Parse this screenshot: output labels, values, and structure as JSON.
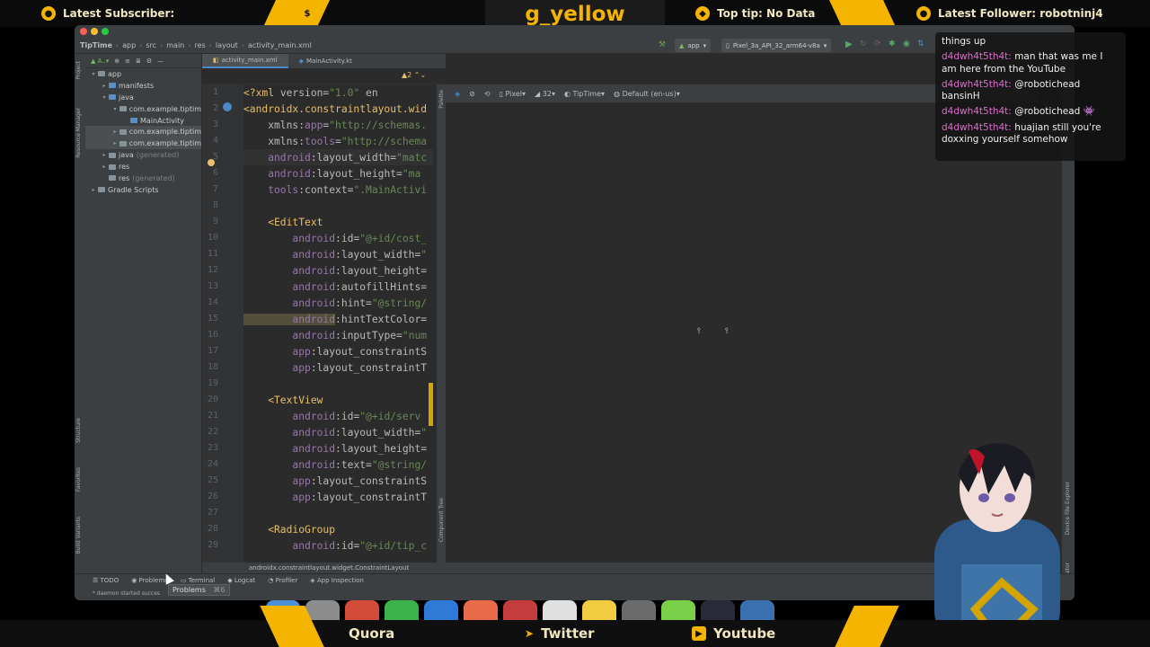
{
  "overlay": {
    "latest_subscriber_label": "Latest Subscriber:",
    "channel_name": "g_yellow",
    "top_tip": "Top tip: No Data",
    "latest_follower": "Latest Follower: robotninj4",
    "bottom_links": [
      "Quora",
      "Twitter",
      "Youtube"
    ]
  },
  "ide": {
    "breadcrumb": [
      "TipTime",
      "app",
      "src",
      "main",
      "res",
      "layout",
      "activity_main.xml"
    ],
    "run_config": "app",
    "device": "Pixel_3a_API_32_arm64-v8a",
    "project_items": [
      {
        "label": "app",
        "indent": 0,
        "arrow": "▾",
        "icon": "folder",
        "muted": ""
      },
      {
        "label": "manifests",
        "indent": 1,
        "arrow": "▸",
        "icon": "blue",
        "muted": ""
      },
      {
        "label": "java",
        "indent": 1,
        "arrow": "▾",
        "icon": "blue",
        "muted": ""
      },
      {
        "label": "com.example.tiptim",
        "indent": 2,
        "arrow": "▾",
        "icon": "folder",
        "muted": ""
      },
      {
        "label": "MainActivity",
        "indent": 3,
        "arrow": "",
        "icon": "blue",
        "muted": ""
      },
      {
        "label": "com.example.tiptim",
        "indent": 2,
        "arrow": "▸",
        "icon": "folder",
        "muted": "",
        "sel": true
      },
      {
        "label": "com.example.tiptim",
        "indent": 2,
        "arrow": "▸",
        "icon": "folder",
        "muted": "",
        "sel": true
      },
      {
        "label": "java",
        "indent": 1,
        "arrow": "▸",
        "icon": "folder",
        "muted": "(generated)"
      },
      {
        "label": "res",
        "indent": 1,
        "arrow": "▸",
        "icon": "folder",
        "muted": ""
      },
      {
        "label": "res",
        "indent": 1,
        "arrow": "",
        "icon": "folder",
        "muted": "(generated)"
      },
      {
        "label": "Gradle Scripts",
        "indent": 0,
        "arrow": "▸",
        "icon": "folder",
        "muted": ""
      }
    ],
    "tabs": [
      "activity_main.xml",
      "MainActivity.kt"
    ],
    "design_toolbar": {
      "device": "Pixel",
      "api": "32",
      "theme": "TipTime",
      "locale": "Default (en-us)"
    },
    "code_lines": [
      {
        "n": "1",
        "parts": [
          [
            "xmlp",
            "<?xml "
          ],
          [
            "attr",
            "version="
          ],
          [
            "val",
            "\"1.0\""
          ],
          [
            "attr",
            " en"
          ]
        ]
      },
      {
        "n": "2",
        "parts": [
          [
            "tag",
            "<androidx.constraintlayout.wid"
          ]
        ]
      },
      {
        "n": "3",
        "parts": [
          [
            "attr",
            "    xmlns:"
          ],
          [
            "attr-ns",
            "app"
          ],
          [
            "attr",
            "="
          ],
          [
            "val",
            "\"http://schemas."
          ]
        ]
      },
      {
        "n": "4",
        "parts": [
          [
            "attr",
            "    xmlns:"
          ],
          [
            "attr-ns",
            "tools"
          ],
          [
            "attr",
            "="
          ],
          [
            "val",
            "\"http://schema"
          ]
        ]
      },
      {
        "n": "5",
        "parts": [
          [
            "attr-ns",
            "    android"
          ],
          [
            "attr",
            ":layout_width="
          ],
          [
            "val",
            "\"matc"
          ]
        ],
        "hl": true
      },
      {
        "n": "6",
        "parts": [
          [
            "attr-ns",
            "    android"
          ],
          [
            "attr",
            ":layout_height="
          ],
          [
            "val",
            "\"ma"
          ]
        ]
      },
      {
        "n": "7",
        "parts": [
          [
            "attr-ns",
            "    tools"
          ],
          [
            "attr",
            ":context="
          ],
          [
            "val",
            "\".MainActivi"
          ]
        ]
      },
      {
        "n": "8",
        "parts": [
          [
            "attr",
            ""
          ]
        ]
      },
      {
        "n": "9",
        "parts": [
          [
            "tag",
            "    <EditText"
          ]
        ]
      },
      {
        "n": "10",
        "parts": [
          [
            "attr-ns",
            "        android"
          ],
          [
            "attr",
            ":id="
          ],
          [
            "val",
            "\"@+id/cost_"
          ]
        ]
      },
      {
        "n": "11",
        "parts": [
          [
            "attr-ns",
            "        android"
          ],
          [
            "attr",
            ":layout_width="
          ],
          [
            "val",
            "\""
          ]
        ]
      },
      {
        "n": "12",
        "parts": [
          [
            "attr-ns",
            "        android"
          ],
          [
            "attr",
            ":layout_height="
          ]
        ]
      },
      {
        "n": "13",
        "parts": [
          [
            "attr-ns",
            "        android"
          ],
          [
            "attr",
            ":autofillHints="
          ]
        ]
      },
      {
        "n": "14",
        "parts": [
          [
            "attr-ns",
            "        android"
          ],
          [
            "attr",
            ":hint="
          ],
          [
            "val",
            "\"@string/"
          ]
        ]
      },
      {
        "n": "15",
        "parts": [
          [
            "attr-ns",
            "        android"
          ],
          [
            "attr",
            ":hintTextColor="
          ]
        ],
        "warn": true
      },
      {
        "n": "16",
        "parts": [
          [
            "attr-ns",
            "        android"
          ],
          [
            "attr",
            ":inputType="
          ],
          [
            "val",
            "\"num"
          ]
        ]
      },
      {
        "n": "17",
        "parts": [
          [
            "attr-ns",
            "        app"
          ],
          [
            "attr",
            ":layout_constraintS"
          ]
        ]
      },
      {
        "n": "18",
        "parts": [
          [
            "attr-ns",
            "        app"
          ],
          [
            "attr",
            ":layout_constraintT"
          ]
        ]
      },
      {
        "n": "19",
        "parts": [
          [
            "attr",
            ""
          ]
        ]
      },
      {
        "n": "20",
        "parts": [
          [
            "tag",
            "    <TextView"
          ]
        ]
      },
      {
        "n": "21",
        "parts": [
          [
            "attr-ns",
            "        android"
          ],
          [
            "attr",
            ":id="
          ],
          [
            "val",
            "\"@+id/serv"
          ]
        ]
      },
      {
        "n": "22",
        "parts": [
          [
            "attr-ns",
            "        android"
          ],
          [
            "attr",
            ":layout_width="
          ],
          [
            "val",
            "\""
          ]
        ]
      },
      {
        "n": "23",
        "parts": [
          [
            "attr-ns",
            "        android"
          ],
          [
            "attr",
            ":layout_height="
          ]
        ]
      },
      {
        "n": "24",
        "parts": [
          [
            "attr-ns",
            "        android"
          ],
          [
            "attr",
            ":text="
          ],
          [
            "val",
            "\"@string/"
          ]
        ]
      },
      {
        "n": "25",
        "parts": [
          [
            "attr-ns",
            "        app"
          ],
          [
            "attr",
            ":layout_constraintS"
          ]
        ]
      },
      {
        "n": "26",
        "parts": [
          [
            "attr-ns",
            "        app"
          ],
          [
            "attr",
            ":layout_constraintT"
          ]
        ]
      },
      {
        "n": "27",
        "parts": [
          [
            "attr",
            ""
          ]
        ]
      },
      {
        "n": "28",
        "parts": [
          [
            "tag",
            "    <RadioGroup"
          ]
        ]
      },
      {
        "n": "29",
        "parts": [
          [
            "attr-ns",
            "        android"
          ],
          [
            "attr",
            ":id="
          ],
          [
            "val",
            "\"@+id/tip_c"
          ]
        ]
      }
    ],
    "status_breadcrumb": "androidx.constraintlayout.widget.ConstraintLayout",
    "bottom_tools": [
      "TODO",
      "Problems",
      "Terminal",
      "Logcat",
      "Profiler",
      "App Inspection"
    ],
    "status_text": "* daemon started succes",
    "tooltip": "Problems",
    "tooltip_shortcut": "⌘6",
    "left_vertical": [
      "Project",
      "Resource Manager",
      "Structure",
      "Favorites",
      "Build Variants"
    ],
    "right_vertical": [
      "Device File Explorer",
      "Emulator"
    ]
  },
  "chat": [
    {
      "user": "",
      "text": "things up"
    },
    {
      "user": "d4dwh4t5th4t:",
      "text": "man that was me I am here from the YouTube"
    },
    {
      "user": "d4dwh4t5th4t:",
      "text": "@robotichead bansinH"
    },
    {
      "user": "d4dwh4t5th4t:",
      "text": "@robotichead 👾"
    },
    {
      "user": "d4dwh4t5th4t:",
      "text": "huajian still you're doxxing yourself somehow"
    }
  ],
  "colors": {
    "accent": "#f4b400",
    "chat_user": "#e06ad0"
  }
}
